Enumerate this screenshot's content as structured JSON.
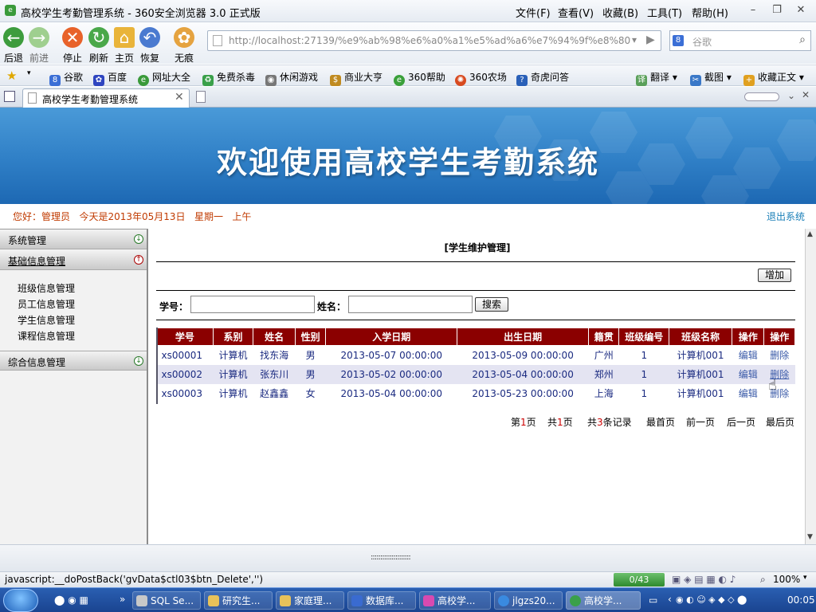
{
  "window": {
    "title": "高校学生考勤管理系统 - 360安全浏览器 3.0 正式版",
    "menus": [
      "文件(F)",
      "查看(V)",
      "收藏(B)",
      "工具(T)",
      "帮助(H)"
    ]
  },
  "toolbar": {
    "back": "后退",
    "forward": "前进",
    "stop": "停止",
    "refresh": "刷新",
    "home": "主页",
    "restore": "恢复",
    "notrace": "无痕",
    "address": "http://localhost:27139/%e9%ab%98%e6%a0%a1%e5%ad%a6%e7%94%9f%e8%80%",
    "address_host": "localhost",
    "search_placeholder": "谷歌"
  },
  "favorites": {
    "items": [
      "谷歌",
      "百度",
      "网址大全",
      "免费杀毒",
      "休闲游戏",
      "商业大亨",
      "360帮助",
      "360农场",
      "奇虎问答"
    ],
    "right": [
      "翻译",
      "截图",
      "收藏正文"
    ]
  },
  "tabs": {
    "active": "高校学生考勤管理系统"
  },
  "banner": {
    "title": "欢迎使用高校学生考勤系统"
  },
  "info": {
    "greeting": "您好：管理员   今天是2013年05月13日   星期一   上午",
    "logout": "退出系统"
  },
  "sidebar": {
    "groups": [
      "系统管理",
      "基础信息管理",
      "综合信息管理"
    ],
    "items": [
      "班级信息管理",
      "员工信息管理",
      "学生信息管理",
      "课程信息管理"
    ]
  },
  "main": {
    "title": "[学生维护管理]",
    "add": "增加",
    "id_label": "学号：",
    "name_label": "姓名：",
    "search": "搜索",
    "columns": [
      "学号",
      "系别",
      "姓名",
      "性别",
      "入学日期",
      "出生日期",
      "籍贯",
      "班级编号",
      "班级名称",
      "操作",
      "操作"
    ],
    "rows": [
      [
        "xs00001",
        "计算机",
        "找东海",
        "男",
        "2013-05-07 00:00:00",
        "2013-05-09 00:00:00",
        "广州",
        "1",
        "计算机001",
        "编辑",
        "删除"
      ],
      [
        "xs00002",
        "计算机",
        "张东川",
        "男",
        "2013-05-02 00:00:00",
        "2013-05-04 00:00:00",
        "郑州",
        "1",
        "计算机001",
        "编辑",
        "删除"
      ],
      [
        "xs00003",
        "计算机",
        "赵鑫鑫",
        "女",
        "2013-05-04 00:00:00",
        "2013-05-23 00:00:00",
        "上海",
        "1",
        "计算机001",
        "编辑",
        "删除"
      ]
    ],
    "pager": {
      "page_pre": "第",
      "page_num": "1",
      "page_post": "页",
      "total_pre": "共",
      "total_num": "1",
      "total_post": "页",
      "rec_pre": "共",
      "rec_num": "3",
      "rec_post": "条记录",
      "first": "最首页",
      "prev": "前一页",
      "next": "后一页",
      "last": "最后页"
    }
  },
  "splitter": ":::::::::::::::::::::",
  "status": {
    "text": "javascript:__doPostBack('gvData$ctl03$btn_Delete','')",
    "counter": "0/43",
    "zoom": "100%"
  },
  "taskbar": {
    "items": [
      "SQL Se...",
      "研究生...",
      "家庭理...",
      "数据库...",
      "高校学...",
      "jlgzs20...",
      "高校学..."
    ],
    "clock": "00:05"
  }
}
